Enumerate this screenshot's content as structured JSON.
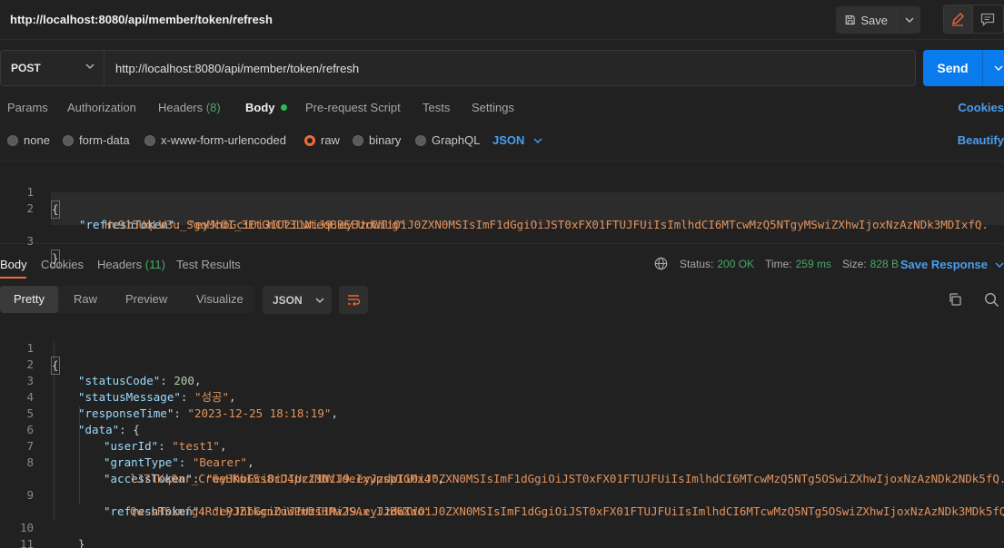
{
  "titlebar": {
    "title": "http://localhost:8080/api/member/token/refresh",
    "save_label": "Save"
  },
  "request": {
    "method": "POST",
    "url": "http://localhost:8080/api/member/token/refresh",
    "send_label": "Send"
  },
  "req_tabs": {
    "params": "Params",
    "authorization": "Authorization",
    "headers": "Headers",
    "headers_count": "(8)",
    "body": "Body",
    "prerequest": "Pre-request Script",
    "tests": "Tests",
    "settings": "Settings",
    "cookies": "Cookies"
  },
  "body_types": {
    "options": [
      "none",
      "form-data",
      "x-www-form-urlencoded",
      "raw",
      "binary",
      "GraphQL"
    ],
    "selected": "raw",
    "format": "JSON",
    "beautify": "Beautify"
  },
  "request_body": {
    "line_numbers": [
      "1",
      "2",
      "3"
    ],
    "open": "{",
    "key": "\"refreshToken\"",
    "value_1": "\"eyJhbGciOiJIUzI1NiJ9.eyJzdWIiOiJ0ZXN0MSIsImF1dGgiOiJST0xFX01FTUJFUiIsImlhdCI6MTcwMzQ5NTgyMSwiZXhwIjoxNzAzNDk3MDIxfQ.",
    "value_2": "Hc915UqLW3u_SgoMcUI_3EtGmCT3LwteqBBEFUrCmUg\"",
    "close": "}"
  },
  "resp_tabs": {
    "body": "Body",
    "cookies": "Cookies",
    "headers": "Headers",
    "headers_count": "(11)",
    "test_results": "Test Results"
  },
  "status": {
    "status_label": "Status:",
    "status_value": "200 OK",
    "time_label": "Time:",
    "time_value": "259 ms",
    "size_label": "Size:",
    "size_value": "828 B",
    "save_response": "Save Response"
  },
  "view": {
    "tabs": [
      "Pretty",
      "Raw",
      "Preview",
      "Visualize"
    ],
    "active": "Pretty",
    "format": "JSON"
  },
  "response_body": {
    "line_numbers": [
      "1",
      "2",
      "3",
      "4",
      "5",
      "6",
      "7",
      "8",
      "9",
      "10",
      "11"
    ],
    "l1": "{",
    "status_code_key": "\"statusCode\"",
    "status_code_val": "200",
    "status_msg_key": "\"statusMessage\"",
    "status_msg_val": "\"성공\"",
    "resp_time_key": "\"responseTime\"",
    "resp_time_val": "\"2023-12-25 18:18:19\"",
    "data_key": "\"data\"",
    "user_id_key": "\"userId\"",
    "user_id_val": "\"test1\"",
    "grant_key": "\"grantType\"",
    "grant_val": "\"Bearer\"",
    "access_key": "\"accessToken\"",
    "access_val_1": "\"eyJhbGciOiJIUzI1NiJ9.eyJzdWIiOiJ0ZXN0MSIsImF1dGgiOiJST0xFX01FTUJFUiIsImlhdCI6MTcwMzQ5NTg5OSwiZXhwIjoxNzAzNDk2NDk5fQ.",
    "access_val_2": "lJ7lKq0ar_Cr6eHKuI5s8rD4przMDV1deIxypspIGMx4\"",
    "refresh_key": "\"refreshToken\"",
    "refresh_val_1": "\"eyJhbGciOiJIUzI1NiJ9.eyJzdWIiOiJ0ZXN0MSIsImF1dGgiOiJST0xFX01FTUJFUiIsImlhdCI6MTcwMzQ5NTg5OSwiZXhwIjoxNzAzNDk3MDk5fQ.",
    "refresh_val_2": "Qw-sHSimfg4RdLPJZIkgnZuWPmBsHPw2SAx_IJB6XWo\"",
    "inner_close": "}",
    "outer_close": "}"
  }
}
